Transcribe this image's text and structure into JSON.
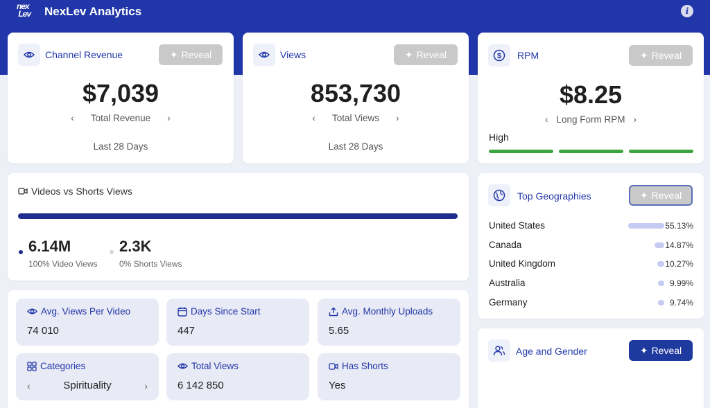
{
  "header": {
    "brand": "NexLev Analytics",
    "logo_text": "nex lev"
  },
  "channel_revenue": {
    "title": "Channel Revenue",
    "reveal": "Reveal",
    "value": "$7,039",
    "subtitle": "Total Revenue",
    "period": "Last 28 Days"
  },
  "views": {
    "title": "Views",
    "reveal": "Reveal",
    "value": "853,730",
    "subtitle": "Total Views",
    "period": "Last 28 Days"
  },
  "rpm": {
    "title": "RPM",
    "reveal": "Reveal",
    "value": "$8.25",
    "subtitle": "Long Form RPM",
    "level": "High",
    "level_color": "#3da53d"
  },
  "videos_vs_shorts": {
    "title": "Videos vs Shorts Views",
    "video_value": "6.14M",
    "video_label": "100% Video Views",
    "video_fraction": 1.0,
    "shorts_value": "2.3K",
    "shorts_label": "0% Shorts Views",
    "shorts_fraction": 0.0
  },
  "stats": {
    "avg_views": {
      "label": "Avg. Views Per Video",
      "value": "74 010"
    },
    "days_since_start": {
      "label": "Days Since Start",
      "value": "447"
    },
    "avg_monthly_uploads": {
      "label": "Avg. Monthly Uploads",
      "value": "5.65"
    },
    "categories": {
      "label": "Categories",
      "value": "Spirituality"
    },
    "total_views": {
      "label": "Total Views",
      "value": "6 142 850"
    },
    "has_shorts": {
      "label": "Has Shorts",
      "value": "Yes"
    }
  },
  "geographies": {
    "title": "Top Geographies",
    "reveal": "Reveal",
    "items": [
      {
        "name": "United States",
        "pct": "55.13%",
        "share": 0.5513
      },
      {
        "name": "Canada",
        "pct": "14.87%",
        "share": 0.1487
      },
      {
        "name": "United Kingdom",
        "pct": "10.27%",
        "share": 0.1027
      },
      {
        "name": "Australia",
        "pct": "9.99%",
        "share": 0.0999
      },
      {
        "name": "Germany",
        "pct": "9.74%",
        "share": 0.0974
      }
    ]
  },
  "age_gender": {
    "title": "Age and Gender",
    "reveal": "Reveal"
  },
  "colors": {
    "primary": "#2136a8",
    "button_disabled": "#c9c9c9",
    "button_active": "#1f3a9e",
    "geo_bar": "#c6cbf3"
  }
}
